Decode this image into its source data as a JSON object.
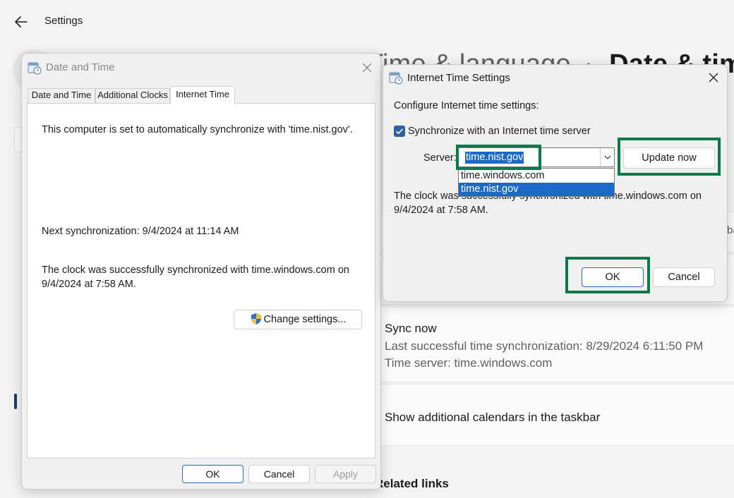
{
  "settings": {
    "title": "Settings",
    "heading_crumb": "Time & language",
    "heading_separator": "›",
    "heading_page": "Date & time",
    "partial_text": "ba",
    "sync": {
      "title": "Sync now",
      "last_sync": "Last successful time synchronization: 8/29/2024 6:11:50 PM",
      "time_server": "Time server: time.windows.com"
    },
    "calendars_label": "Show additional calendars in the taskbar",
    "related_links": "Related links"
  },
  "date_time_dialog": {
    "title": "Date and Time",
    "tabs": [
      {
        "label": "Date and Time",
        "selected": false
      },
      {
        "label": "Additional Clocks",
        "selected": false
      },
      {
        "label": "Internet Time",
        "selected": true
      }
    ],
    "auto_sync_text": "This computer is set to automatically synchronize with 'time.nist.gov'.",
    "next_sync_text": "Next synchronization: 9/4/2024 at 11:14 AM",
    "clock_sync_text": "The clock was successfully synchronized with time.windows.com on 9/4/2024 at 7:58 AM.",
    "change_settings_label": "Change settings...",
    "ok_label": "OK",
    "cancel_label": "Cancel",
    "apply_label": "Apply"
  },
  "internet_time_dialog": {
    "title": "Internet Time Settings",
    "configure_label": "Configure Internet time settings:",
    "sync_checkbox_label": "Synchronize with an Internet time server",
    "sync_checked": true,
    "server_label": "Server:",
    "server_value": "time.nist.gov",
    "server_options": [
      "time.windows.com",
      "time.nist.gov"
    ],
    "selected_option": "time.nist.gov",
    "update_now_label": "Update now",
    "message": "The clock was successfully synchronized with time.windows.com on 9/4/2024 at 7:58 AM.",
    "ok_label": "OK",
    "cancel_label": "Cancel"
  },
  "colors": {
    "highlight": "#0b7a4b",
    "selection": "#1b6ac9",
    "checkbox": "#2d5f9e"
  }
}
